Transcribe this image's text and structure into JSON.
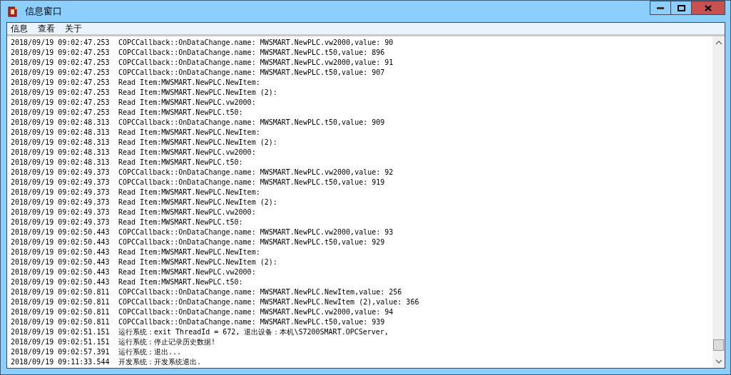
{
  "window": {
    "title": "信息窗口"
  },
  "menu": [
    {
      "label": "信息"
    },
    {
      "label": "查看"
    },
    {
      "label": "关于"
    }
  ],
  "log": [
    {
      "time": "2018/09/19 09:02:47.253",
      "message": "COPCCallback::OnDataChange.name: MWSMART.NewPLC.vw2000,value: 90"
    },
    {
      "time": "2018/09/19 09:02:47.253",
      "message": "COPCCallback::OnDataChange.name: MWSMART.NewPLC.t50,value: 896"
    },
    {
      "time": "2018/09/19 09:02:47.253",
      "message": "COPCCallback::OnDataChange.name: MWSMART.NewPLC.vw2000,value: 91"
    },
    {
      "time": "2018/09/19 09:02:47.253",
      "message": "COPCCallback::OnDataChange.name: MWSMART.NewPLC.t50,value: 907"
    },
    {
      "time": "2018/09/19 09:02:47.253",
      "message": "Read Item:MWSMART.NewPLC.NewItem:"
    },
    {
      "time": "2018/09/19 09:02:47.253",
      "message": "Read Item:MWSMART.NewPLC.NewItem (2):"
    },
    {
      "time": "2018/09/19 09:02:47.253",
      "message": "Read Item:MWSMART.NewPLC.vw2000:"
    },
    {
      "time": "2018/09/19 09:02:47.253",
      "message": "Read Item:MWSMART.NewPLC.t50:"
    },
    {
      "time": "2018/09/19 09:02:48.313",
      "message": "COPCCallback::OnDataChange.name: MWSMART.NewPLC.t50,value: 909"
    },
    {
      "time": "2018/09/19 09:02:48.313",
      "message": "Read Item:MWSMART.NewPLC.NewItem:"
    },
    {
      "time": "2018/09/19 09:02:48.313",
      "message": "Read Item:MWSMART.NewPLC.NewItem (2):"
    },
    {
      "time": "2018/09/19 09:02:48.313",
      "message": "Read Item:MWSMART.NewPLC.vw2000:"
    },
    {
      "time": "2018/09/19 09:02:48.313",
      "message": "Read Item:MWSMART.NewPLC.t50:"
    },
    {
      "time": "2018/09/19 09:02:49.373",
      "message": "COPCCallback::OnDataChange.name: MWSMART.NewPLC.vw2000,value: 92"
    },
    {
      "time": "2018/09/19 09:02:49.373",
      "message": "COPCCallback::OnDataChange.name: MWSMART.NewPLC.t50,value: 919"
    },
    {
      "time": "2018/09/19 09:02:49.373",
      "message": "Read Item:MWSMART.NewPLC.NewItem:"
    },
    {
      "time": "2018/09/19 09:02:49.373",
      "message": "Read Item:MWSMART.NewPLC.NewItem (2):"
    },
    {
      "time": "2018/09/19 09:02:49.373",
      "message": "Read Item:MWSMART.NewPLC.vw2000:"
    },
    {
      "time": "2018/09/19 09:02:49.373",
      "message": "Read Item:MWSMART.NewPLC.t50:"
    },
    {
      "time": "2018/09/19 09:02:50.443",
      "message": "COPCCallback::OnDataChange.name: MWSMART.NewPLC.vw2000,value: 93"
    },
    {
      "time": "2018/09/19 09:02:50.443",
      "message": "COPCCallback::OnDataChange.name: MWSMART.NewPLC.t50,value: 929"
    },
    {
      "time": "2018/09/19 09:02:50.443",
      "message": "Read Item:MWSMART.NewPLC.NewItem:"
    },
    {
      "time": "2018/09/19 09:02:50.443",
      "message": "Read Item:MWSMART.NewPLC.NewItem (2):"
    },
    {
      "time": "2018/09/19 09:02:50.443",
      "message": "Read Item:MWSMART.NewPLC.vw2000:"
    },
    {
      "time": "2018/09/19 09:02:50.443",
      "message": "Read Item:MWSMART.NewPLC.t50:"
    },
    {
      "time": "2018/09/19 09:02:50.811",
      "message": "COPCCallback::OnDataChange.name: MWSMART.NewPLC.NewItem,value: 256"
    },
    {
      "time": "2018/09/19 09:02:50.811",
      "message": "COPCCallback::OnDataChange.name: MWSMART.NewPLC.NewItem (2),value: 366"
    },
    {
      "time": "2018/09/19 09:02:50.811",
      "message": "COPCCallback::OnDataChange.name: MWSMART.NewPLC.vw2000,value: 94"
    },
    {
      "time": "2018/09/19 09:02:50.811",
      "message": "COPCCallback::OnDataChange.name: MWSMART.NewPLC.t50,value: 939"
    },
    {
      "time": "2018/09/19 09:02:51.151",
      "message": "运行系统：exit ThreadId = 672, 退出设备：本机\\S7200SMART.OPCServer,"
    },
    {
      "time": "2018/09/19 09:02:51.151",
      "message": "运行系统：停止记录历史数据!"
    },
    {
      "time": "2018/09/19 09:02:57.391",
      "message": "运行系统：退出..."
    },
    {
      "time": "2018/09/19 09:11:33.544",
      "message": "开发系统：开发系统退出."
    }
  ]
}
